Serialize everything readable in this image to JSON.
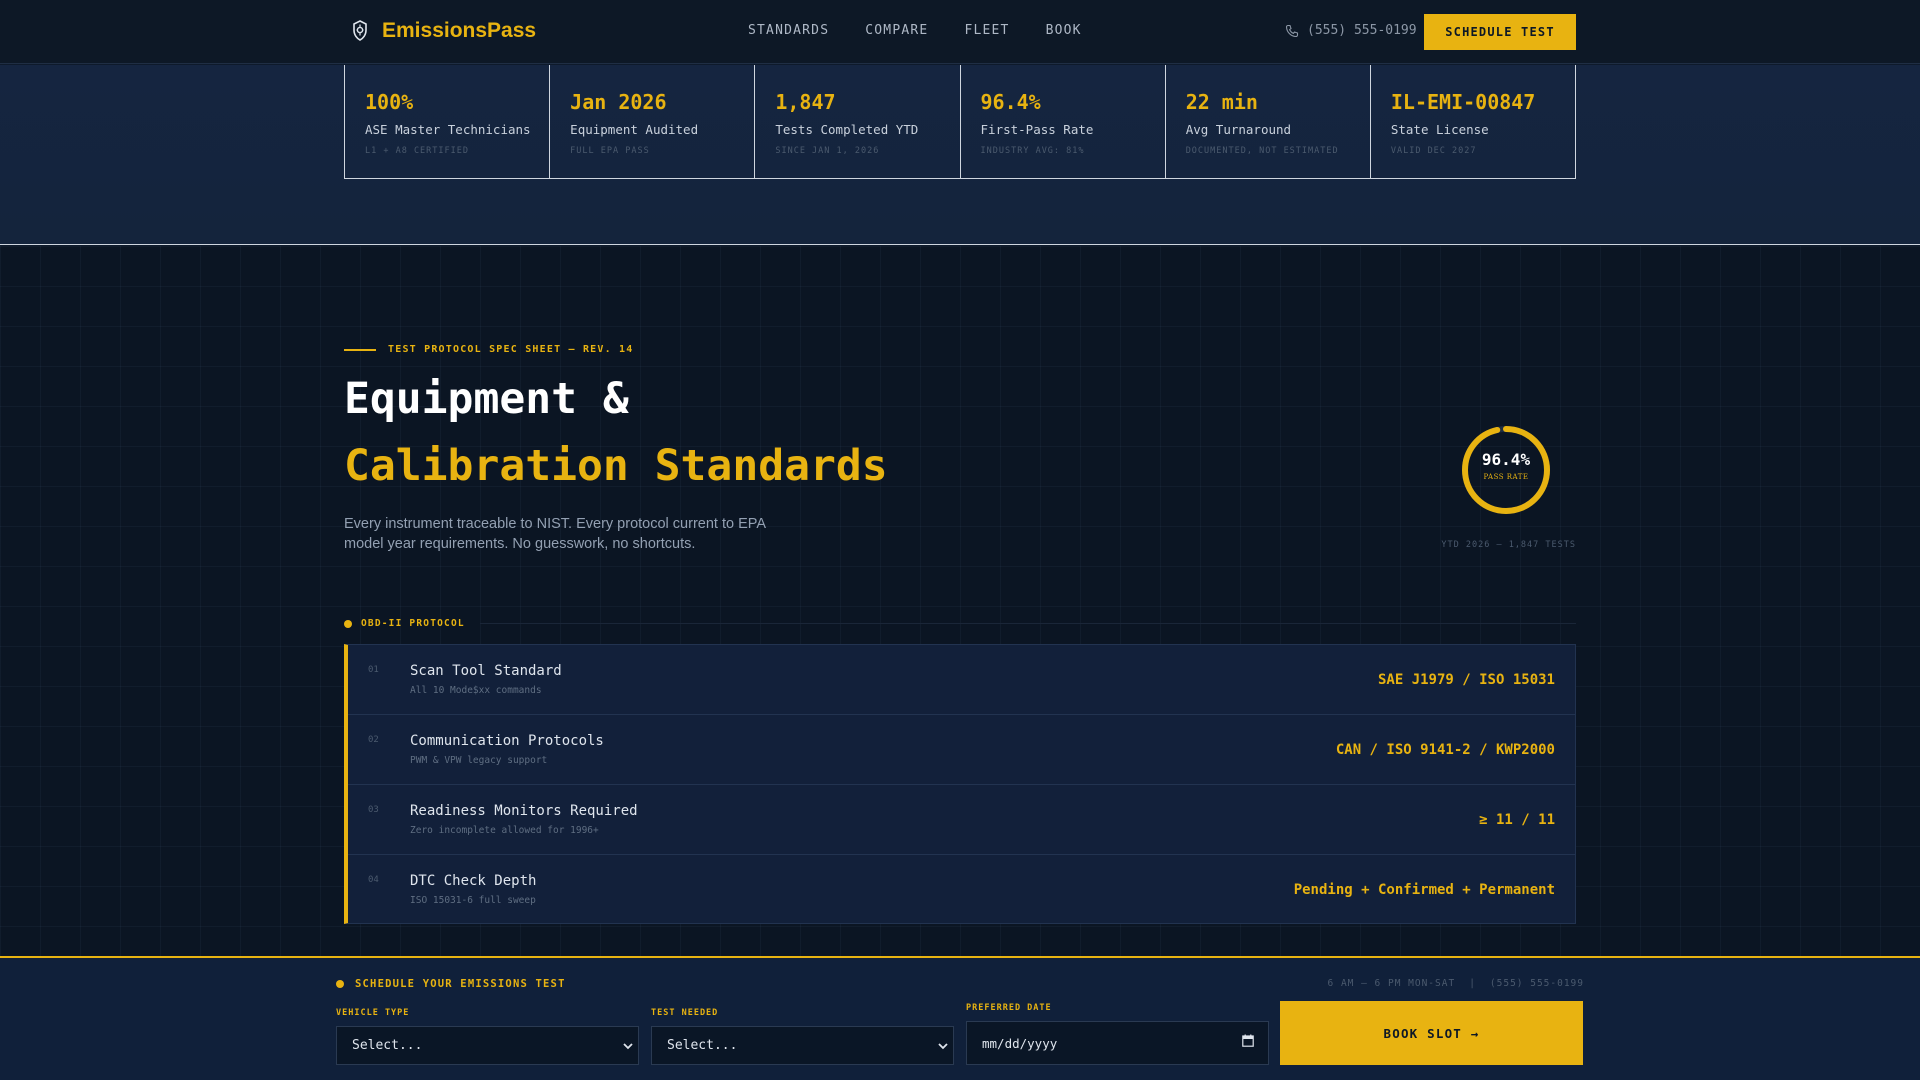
{
  "nav": {
    "brand": "EmissionsPass",
    "links": [
      "STANDARDS",
      "COMPARE",
      "FLEET",
      "BOOK"
    ],
    "phone": "(555) 555-0199",
    "cta": "SCHEDULE TEST"
  },
  "stats": [
    {
      "value": "100%",
      "label": "ASE Master Technicians",
      "sub": "L1 + A8 CERTIFIED"
    },
    {
      "value": "Jan 2026",
      "label": "Equipment Audited",
      "sub": "FULL EPA PASS"
    },
    {
      "value": "1,847",
      "label": "Tests Completed YTD",
      "sub": "SINCE JAN 1, 2026"
    },
    {
      "value": "96.4%",
      "label": "First-Pass Rate",
      "sub": "INDUSTRY AVG: 81%"
    },
    {
      "value": "22 min",
      "label": "Avg Turnaround",
      "sub": "DOCUMENTED, NOT ESTIMATED"
    },
    {
      "value": "IL-EMI-00847",
      "label": "State License",
      "sub": "VALID DEC 2027"
    }
  ],
  "hero": {
    "eyebrow": "TEST PROTOCOL SPEC SHEET — REV. 14",
    "title_line1": "Equipment &",
    "title_line2": "Calibration Standards",
    "intro": "Every instrument traceable to NIST. Every protocol current to EPA model year requirements. No guesswork, no shortcuts."
  },
  "gauge": {
    "value_text": "96.4%",
    "fraction": 0.964,
    "label": "PASS RATE",
    "caption": "YTD 2026 — 1,847 TESTS"
  },
  "protocol": {
    "label": "OBD-II PROTOCOL",
    "rows": [
      {
        "num": "01",
        "title": "Scan Tool Standard",
        "sub": "All 10 Mode$xx commands",
        "value": "SAE J1979 / ISO 15031"
      },
      {
        "num": "02",
        "title": "Communication Protocols",
        "sub": "PWM & VPW legacy support",
        "value": "CAN / ISO 9141-2 / KWP2000"
      },
      {
        "num": "03",
        "title": "Readiness Monitors Required",
        "sub": "Zero incomplete allowed for 1996+",
        "value": "≥ 11 / 11"
      },
      {
        "num": "04",
        "title": "DTC Check Depth",
        "sub": "ISO 15031-6 full sweep",
        "value": "Pending + Confirmed + Permanent"
      }
    ]
  },
  "booking": {
    "label": "SCHEDULE YOUR EMISSIONS TEST",
    "hours": "6 AM – 6 PM MON-SAT",
    "separator": "|",
    "phone": "(555) 555-0199",
    "vehicle_label": "VEHICLE TYPE",
    "vehicle_value": "Select...",
    "test_label": "TEST NEEDED",
    "test_value": "Select...",
    "date_label": "PREFERRED DATE",
    "date_placeholder": "mm/dd/yyyy",
    "button": "BOOK SLOT →"
  },
  "colors": {
    "accent": "#e8b311",
    "background": "#0e1a2b",
    "panel": "#12203a"
  },
  "icons": {
    "brand": "emissions-badge-icon",
    "phone": "phone-icon",
    "dropdown": "chevron-down-icon",
    "date": "calendar-icon",
    "status": "status-dot-icon"
  }
}
